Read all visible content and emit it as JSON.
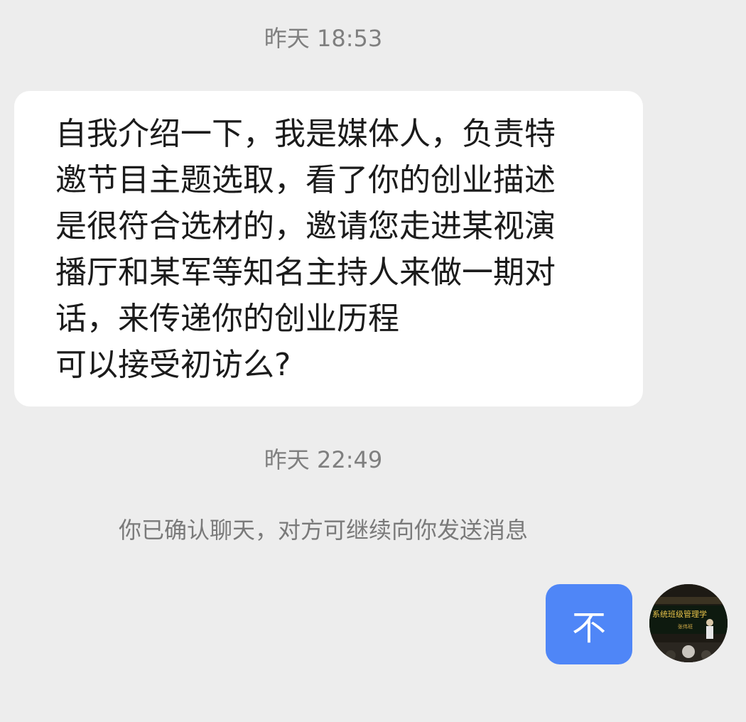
{
  "timestamps": [
    "昨天 18:53",
    "昨天 22:49"
  ],
  "incoming_message": {
    "lines": [
      "自我介绍一下，我是媒体人，负责特",
      "邀节目主题选取，看了你的创业描述",
      "是很符合选材的，邀请您走进某视演",
      "播厅和某军等知名主持人来做一期对",
      "话，来传递你的创业历程",
      "可以接受初访么?"
    ]
  },
  "system_note": "你已确认聊天，对方可继续向你发送消息",
  "outgoing_message": {
    "text": "不"
  },
  "avatar": {
    "banner_text": "系统班级管理学",
    "sub_text": "张伟班",
    "colors": {
      "bg": "#1d1a14",
      "banner": "#e8c34a"
    }
  },
  "colors": {
    "background": "#ededed",
    "incoming_bubble": "#ffffff",
    "outgoing_bubble": "#4f86f7",
    "timestamp_text": "#7f7f7f"
  }
}
